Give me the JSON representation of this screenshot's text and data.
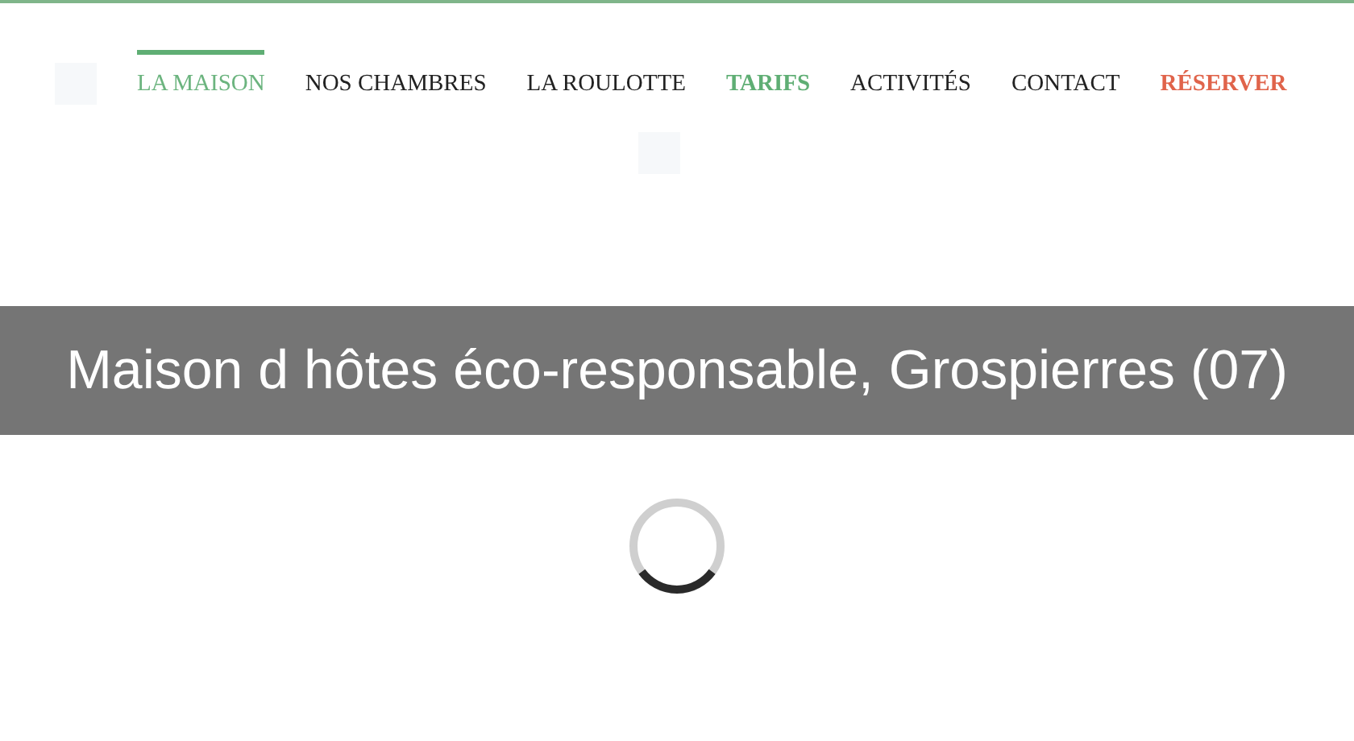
{
  "nav": [
    {
      "label": "LA MAISON",
      "kind": "link",
      "selected": true
    },
    {
      "label": "NOS CHAMBRES",
      "kind": "link",
      "selected": false
    },
    {
      "label": "LA ROULOTTE",
      "kind": "link",
      "selected": false
    },
    {
      "label": "TARIFS",
      "kind": "highlight",
      "selected": false
    },
    {
      "label": "ACTIVITÉS",
      "kind": "link",
      "selected": false
    },
    {
      "label": "CONTACT",
      "kind": "link",
      "selected": false
    },
    {
      "label": "RÉSERVER",
      "kind": "cta",
      "selected": false
    }
  ],
  "banner": {
    "title": "Maison d hôtes éco-responsable, Grospierres (07)"
  },
  "loader": {
    "kind": "spinner"
  }
}
